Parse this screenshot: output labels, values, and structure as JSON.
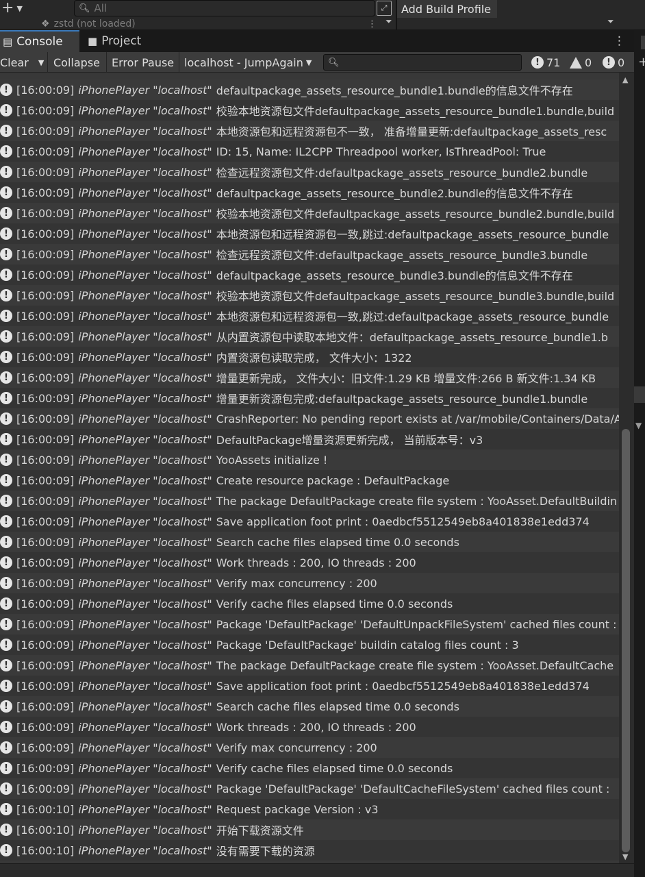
{
  "top": {
    "plus": "+",
    "plus_arrow": "▼",
    "search_placeholder": "All",
    "add_build_profile": "Add Build Profile",
    "zstd_label": "zstd (not loaded)"
  },
  "tabs": [
    {
      "label": "Console"
    },
    {
      "label": "Project"
    }
  ],
  "toolbar": {
    "clear": "Clear",
    "collapse": "Collapse",
    "error_pause": "Error Pause",
    "player": "localhost - JumpAgain",
    "info_count": "71",
    "warn_count": "0",
    "error_count": "0"
  },
  "logs": [
    {
      "time": "[16:00:09]",
      "player": "iPhonePlayer \"localhost\"",
      "msg": "defaultpackage_assets_resource_bundle1.bundle的信息文件不存在"
    },
    {
      "time": "[16:00:09]",
      "player": "iPhonePlayer \"localhost\"",
      "msg": "校验本地资源包文件defaultpackage_assets_resource_bundle1.bundle,build"
    },
    {
      "time": "[16:00:09]",
      "player": "iPhonePlayer \"localhost\"",
      "msg": "本地资源包和远程资源包不一致， 准备增量更新:defaultpackage_assets_resc"
    },
    {
      "time": "[16:00:09]",
      "player": "iPhonePlayer \"localhost\"",
      "msg": "ID: 15, Name: IL2CPP Threadpool worker, IsThreadPool: True"
    },
    {
      "time": "[16:00:09]",
      "player": "iPhonePlayer \"localhost\"",
      "msg": "检查远程资源包文件:defaultpackage_assets_resource_bundle2.bundle"
    },
    {
      "time": "[16:00:09]",
      "player": "iPhonePlayer \"localhost\"",
      "msg": "defaultpackage_assets_resource_bundle2.bundle的信息文件不存在"
    },
    {
      "time": "[16:00:09]",
      "player": "iPhonePlayer \"localhost\"",
      "msg": "校验本地资源包文件defaultpackage_assets_resource_bundle2.bundle,build"
    },
    {
      "time": "[16:00:09]",
      "player": "iPhonePlayer \"localhost\"",
      "msg": "本地资源包和远程资源包一致,跳过:defaultpackage_assets_resource_bundle"
    },
    {
      "time": "[16:00:09]",
      "player": "iPhonePlayer \"localhost\"",
      "msg": "检查远程资源包文件:defaultpackage_assets_resource_bundle3.bundle"
    },
    {
      "time": "[16:00:09]",
      "player": "iPhonePlayer \"localhost\"",
      "msg": "defaultpackage_assets_resource_bundle3.bundle的信息文件不存在"
    },
    {
      "time": "[16:00:09]",
      "player": "iPhonePlayer \"localhost\"",
      "msg": "校验本地资源包文件defaultpackage_assets_resource_bundle3.bundle,build"
    },
    {
      "time": "[16:00:09]",
      "player": "iPhonePlayer \"localhost\"",
      "msg": "本地资源包和远程资源包一致,跳过:defaultpackage_assets_resource_bundle"
    },
    {
      "time": "[16:00:09]",
      "player": "iPhonePlayer \"localhost\"",
      "msg": "从内置资源包中读取本地文件：defaultpackage_assets_resource_bundle1.b"
    },
    {
      "time": "[16:00:09]",
      "player": "iPhonePlayer \"localhost\"",
      "msg": "内置资源包读取完成， 文件大小：1322"
    },
    {
      "time": "[16:00:09]",
      "player": "iPhonePlayer \"localhost\"",
      "msg": "增量更新完成， 文件大小：旧文件:1.29 KB 增量文件:266 B 新文件:1.34 KB"
    },
    {
      "time": "[16:00:09]",
      "player": "iPhonePlayer \"localhost\"",
      "msg": "增量更新资源包完成:defaultpackage_assets_resource_bundle1.bundle"
    },
    {
      "time": "[16:00:09]",
      "player": "iPhonePlayer \"localhost\"",
      "msg": "CrashReporter: No pending report exists at /var/mobile/Containers/Data/A"
    },
    {
      "time": "[16:00:09]",
      "player": "iPhonePlayer \"localhost\"",
      "msg": "DefaultPackage增量资源更新完成， 当前版本号：v3"
    },
    {
      "time": "[16:00:09]",
      "player": "iPhonePlayer \"localhost\"",
      "msg": "YooAssets initialize !"
    },
    {
      "time": "[16:00:09]",
      "player": "iPhonePlayer \"localhost\"",
      "msg": "Create resource package : DefaultPackage"
    },
    {
      "time": "[16:00:09]",
      "player": "iPhonePlayer \"localhost\"",
      "msg": "The package DefaultPackage create file system : YooAsset.DefaultBuildin"
    },
    {
      "time": "[16:00:09]",
      "player": "iPhonePlayer \"localhost\"",
      "msg": "Save application foot print : 0aedbcf5512549eb8a401838e1edd374"
    },
    {
      "time": "[16:00:09]",
      "player": "iPhonePlayer \"localhost\"",
      "msg": "Search cache files elapsed time 0.0 seconds"
    },
    {
      "time": "[16:00:09]",
      "player": "iPhonePlayer \"localhost\"",
      "msg": "Work threads : 200, IO threads : 200"
    },
    {
      "time": "[16:00:09]",
      "player": "iPhonePlayer \"localhost\"",
      "msg": "Verify max concurrency : 200"
    },
    {
      "time": "[16:00:09]",
      "player": "iPhonePlayer \"localhost\"",
      "msg": "Verify cache files elapsed time 0.0 seconds"
    },
    {
      "time": "[16:00:09]",
      "player": "iPhonePlayer \"localhost\"",
      "msg": "Package 'DefaultPackage' 'DefaultUnpackFileSystem' cached files count :"
    },
    {
      "time": "[16:00:09]",
      "player": "iPhonePlayer \"localhost\"",
      "msg": "Package 'DefaultPackage' buildin catalog files count : 3"
    },
    {
      "time": "[16:00:09]",
      "player": "iPhonePlayer \"localhost\"",
      "msg": "The package DefaultPackage create file system : YooAsset.DefaultCache"
    },
    {
      "time": "[16:00:09]",
      "player": "iPhonePlayer \"localhost\"",
      "msg": "Save application foot print : 0aedbcf5512549eb8a401838e1edd374"
    },
    {
      "time": "[16:00:09]",
      "player": "iPhonePlayer \"localhost\"",
      "msg": "Search cache files elapsed time 0.0 seconds"
    },
    {
      "time": "[16:00:09]",
      "player": "iPhonePlayer \"localhost\"",
      "msg": "Work threads : 200, IO threads : 200"
    },
    {
      "time": "[16:00:09]",
      "player": "iPhonePlayer \"localhost\"",
      "msg": "Verify max concurrency : 200"
    },
    {
      "time": "[16:00:09]",
      "player": "iPhonePlayer \"localhost\"",
      "msg": "Verify cache files elapsed time 0.0 seconds"
    },
    {
      "time": "[16:00:09]",
      "player": "iPhonePlayer \"localhost\"",
      "msg": "Package 'DefaultPackage' 'DefaultCacheFileSystem' cached files count : "
    },
    {
      "time": "[16:00:10]",
      "player": "iPhonePlayer \"localhost\"",
      "msg": "Request package Version : v3"
    },
    {
      "time": "[16:00:10]",
      "player": "iPhonePlayer \"localhost\"",
      "msg": "开始下载资源文件"
    },
    {
      "time": "[16:00:10]",
      "player": "iPhonePlayer \"localhost\"",
      "msg": "没有需要下载的资源"
    }
  ]
}
